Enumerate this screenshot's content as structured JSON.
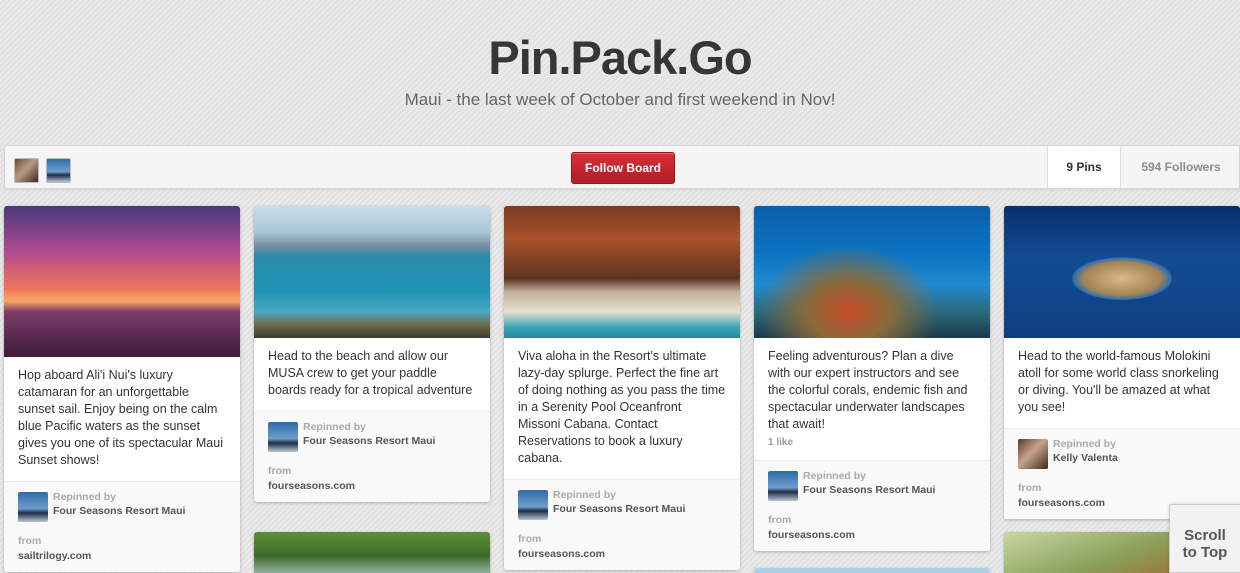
{
  "board": {
    "title": "Pin.Pack.Go",
    "description": "Maui - the last week of October and first weekend in Nov!"
  },
  "toolbar": {
    "follow_label": "Follow Board",
    "pins_label": "9 Pins",
    "followers_label": "594 Followers"
  },
  "pins": [
    {
      "description": "Hop aboard Ali'i Nui's luxury catamaran for an unforgettable sunset sail. Enjoy being on the calm blue Pacific waters as the sunset gives you one of its spectacular Maui Sunset shows!",
      "repinned_label": "Repinned by",
      "repinned_by": "Four Seasons Resort Maui",
      "from_label": "from",
      "source": "sailtrilogy.com"
    },
    {
      "description": "Head to the beach and allow our MUSA crew to get your paddle boards ready for a tropical adventure",
      "repinned_label": "Repinned by",
      "repinned_by": "Four Seasons Resort Maui",
      "from_label": "from",
      "source": "fourseasons.com"
    },
    {
      "description": "Viva aloha in the Resort's ultimate lazy-day splurge. Perfect the fine art of doing nothing as you pass the time in a Serenity Pool Oceanfront Missoni Cabana. Contact Reservations to book a luxury cabana.",
      "repinned_label": "Repinned by",
      "repinned_by": "Four Seasons Resort Maui",
      "from_label": "from",
      "source": "fourseasons.com"
    },
    {
      "description": "Feeling adventurous? Plan a dive with our expert instructors and see the colorful corals, endemic fish and spectacular underwater landscapes that await!",
      "likes": "1 like",
      "repinned_label": "Repinned by",
      "repinned_by": "Four Seasons Resort Maui",
      "from_label": "from",
      "source": "fourseasons.com"
    },
    {
      "description": "Head to the world-famous Molokini atoll for some world class snorkeling or diving. You'll be amazed at what you see!",
      "repinned_label": "Repinned by",
      "repinned_by": "Kelly Valenta",
      "from_label": "from",
      "source": "fourseasons.com"
    }
  ],
  "scroll_top": {
    "line1": "Scroll",
    "line2": "to Top"
  },
  "colors": {
    "follow_button": "#c8232c",
    "background": "#e6e5e5"
  }
}
